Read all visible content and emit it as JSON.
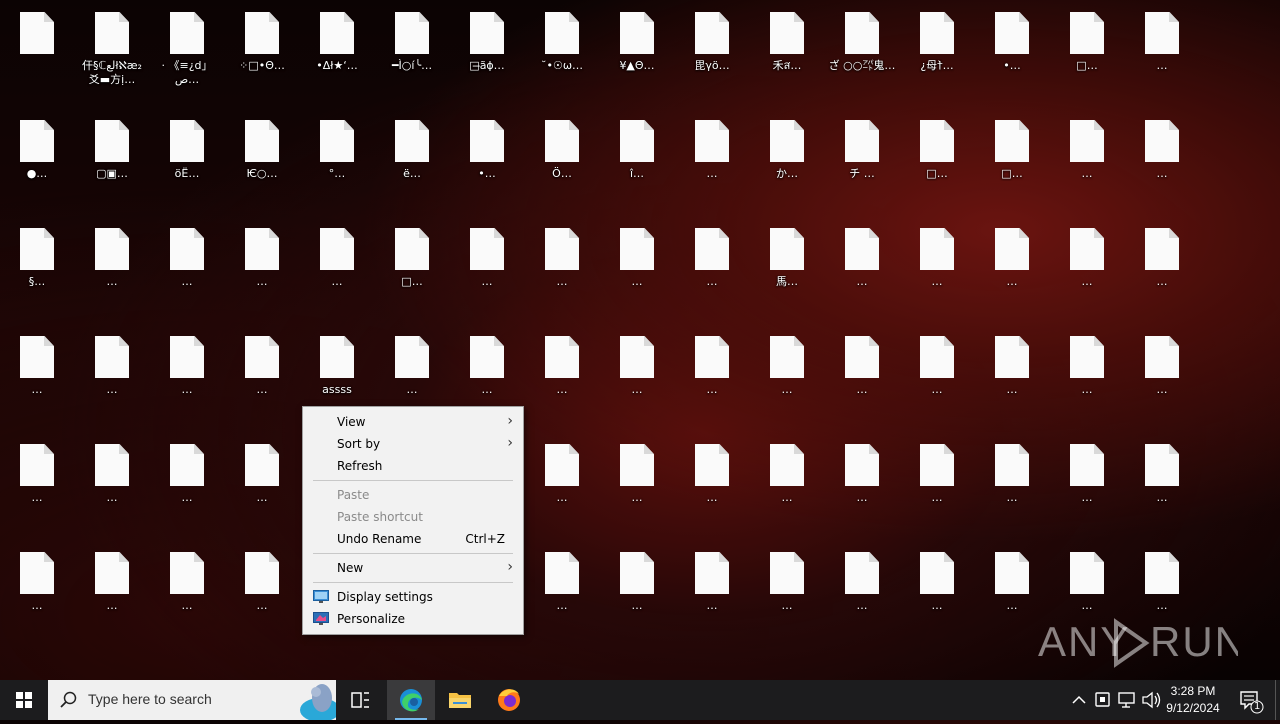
{
  "desktop": {
    "icons": [
      [
        "",
        "仠§ℂلعłℵæ₂ 爻▬⽅ị…",
        "‧ 《≡¿d」ص…",
        "⁘□•Θ…",
        "•Δł★‘…",
        "━Ì○í╰…",
        "□̶ãɸ…",
        "˘•☉ω…",
        "¥▲Θ…",
        "毘γö…",
        "禾ส…",
        "ざ ○○㌀鬼…",
        "¿母†̀…",
        "•…",
        "□…",
        "…"
      ],
      [
        "●…",
        "▢▣…",
        "öË…",
        "Ѥ○…",
        "°…",
        "ë…",
        "•…",
        "Ö…",
        "î…",
        "…",
        "か…",
        "チ …",
        "□…",
        "□…",
        "…",
        "…"
      ],
      [
        "§…",
        "…",
        "…",
        "…",
        "…",
        "□…",
        "…",
        "…",
        "…",
        "…",
        "馬…",
        "…",
        "…",
        "…",
        "…",
        "…"
      ],
      [
        "…",
        "…",
        "…",
        "…",
        "assss",
        "…",
        "…",
        "…",
        "…",
        "…",
        "…",
        "…",
        "…",
        "…",
        "…",
        "…"
      ],
      [
        "…",
        "…",
        "…",
        "…",
        "",
        "",
        "",
        "…",
        "…",
        "…",
        "…",
        "…",
        "…",
        "…",
        "…",
        "…"
      ],
      [
        "…",
        "…",
        "…",
        "…",
        "",
        "",
        "",
        "…",
        "…",
        "…",
        "…",
        "…",
        "…",
        "…",
        "…",
        "…"
      ]
    ]
  },
  "context_menu": {
    "items": [
      {
        "label": "View",
        "submenu": true
      },
      {
        "label": "Sort by",
        "submenu": true
      },
      {
        "label": "Refresh"
      },
      {
        "label": "Paste",
        "disabled": true
      },
      {
        "label": "Paste shortcut",
        "disabled": true
      },
      {
        "label": "Undo Rename",
        "shortcut": "Ctrl+Z"
      },
      {
        "label": "New",
        "submenu": true
      },
      {
        "label": "Display settings",
        "icon": "display-icon"
      },
      {
        "label": "Personalize",
        "icon": "personalize-icon"
      }
    ]
  },
  "taskbar": {
    "search_placeholder": "Type here to search",
    "apps": [
      "task-view-icon",
      "edge-icon",
      "file-explorer-icon",
      "firefox-icon"
    ],
    "tray_icons": [
      "chevron-up-icon",
      "network-icon",
      "monitor-icon",
      "volume-icon"
    ],
    "time": "3:28 PM",
    "date": "9/12/2024",
    "notifications": "1"
  },
  "watermark": "ANY RUN"
}
